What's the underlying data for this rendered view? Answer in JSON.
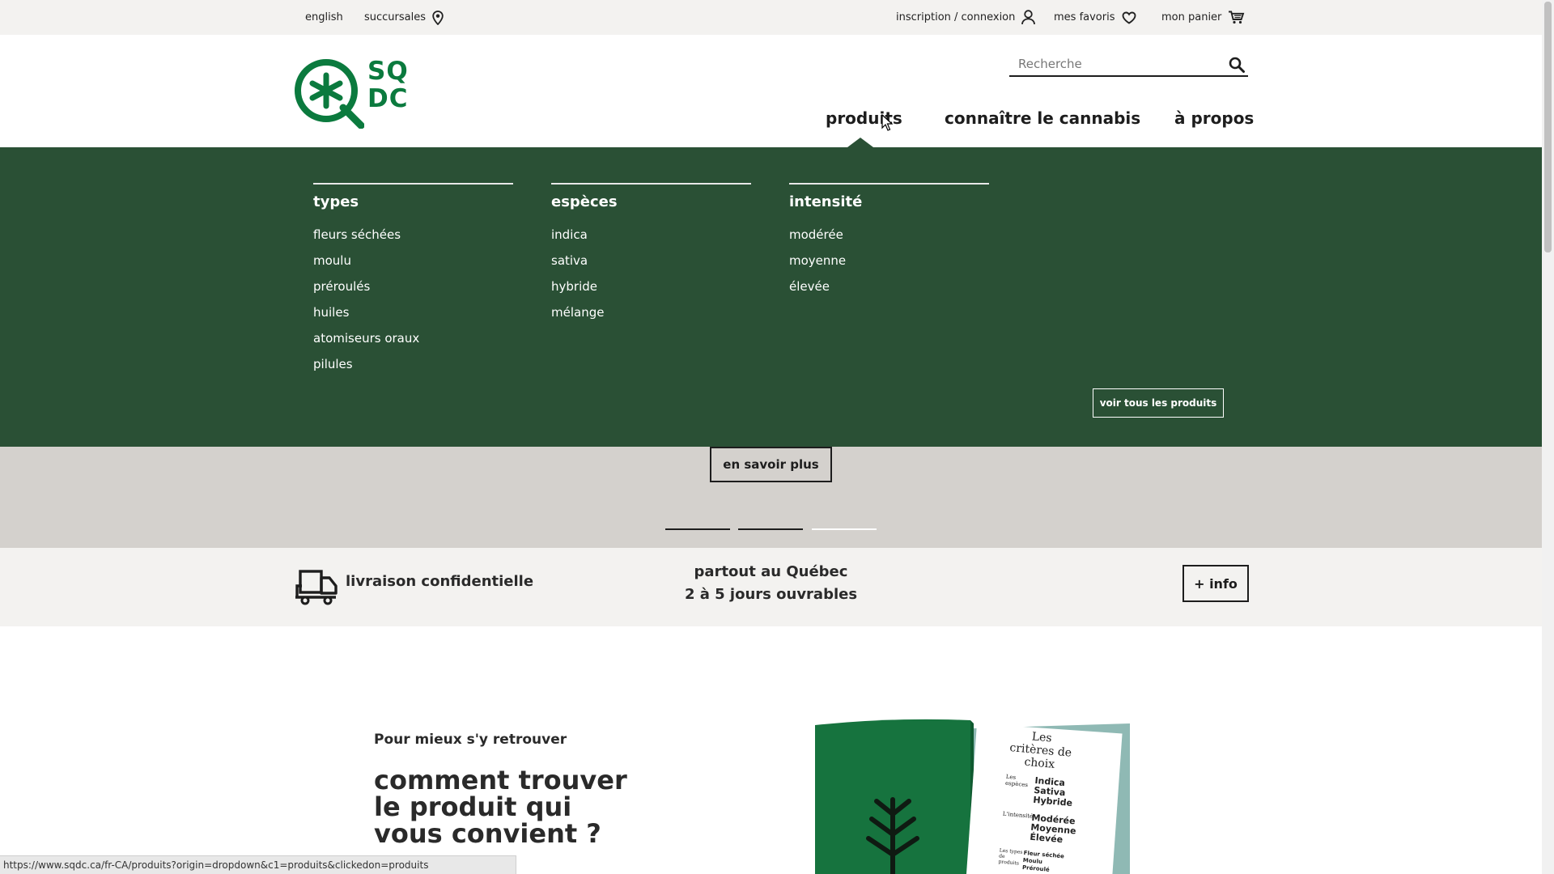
{
  "topbar": {
    "language": "english",
    "branches": "succursales",
    "login": "inscription / connexion",
    "favorites": "mes favoris",
    "cart": "mon panier"
  },
  "header": {
    "logo_text": "SQ DC",
    "search_placeholder": "Recherche",
    "nav": {
      "products": "produits",
      "cannabis": "connaître le cannabis",
      "about": "à propos"
    }
  },
  "mega_menu": {
    "columns": [
      {
        "title": "types",
        "items": [
          "fleurs séchées",
          "moulu",
          "préroulés",
          "huiles",
          "atomiseurs oraux",
          "pilules"
        ]
      },
      {
        "title": "espèces",
        "items": [
          "indica",
          "sativa",
          "hybride",
          "mélange"
        ]
      },
      {
        "title": "intensité",
        "items": [
          "modérée",
          "moyenne",
          "élevée"
        ]
      }
    ],
    "see_all": "voir tous les produits"
  },
  "hero": {
    "learn_more": "en savoir plus",
    "carousel_active_index": 3
  },
  "delivery": {
    "title": "livraison confidentielle",
    "line1": "partout au Québec",
    "line2": "2 à 5 jours ouvrables",
    "info_button": "+ info"
  },
  "guide": {
    "kicker": "Pour mieux s'y retrouver",
    "title": "comment trouver le produit qui vous convient ?",
    "book": {
      "heading": "Les critères de choix",
      "especes_label": "Les espèces",
      "especes": [
        "Indica",
        "Sativa",
        "Hybride"
      ],
      "intensite_label": "L'intensité",
      "intensite": [
        "Modérée",
        "Moyenne",
        "Élevée"
      ],
      "types_label": "Les types de produits",
      "types": [
        "Fleur séchée",
        "Moulu",
        "Préroulé"
      ]
    }
  },
  "statusbar": {
    "url": "https://www.sqdc.ca/fr-CA/produits?origin=dropdown&c1=produits&clickedon=produits"
  },
  "colors": {
    "brand_green": "#0b7a3e",
    "menu_green": "#2a5035",
    "hero_gray": "#d4d1cd",
    "band_gray": "#f3f2f0"
  }
}
